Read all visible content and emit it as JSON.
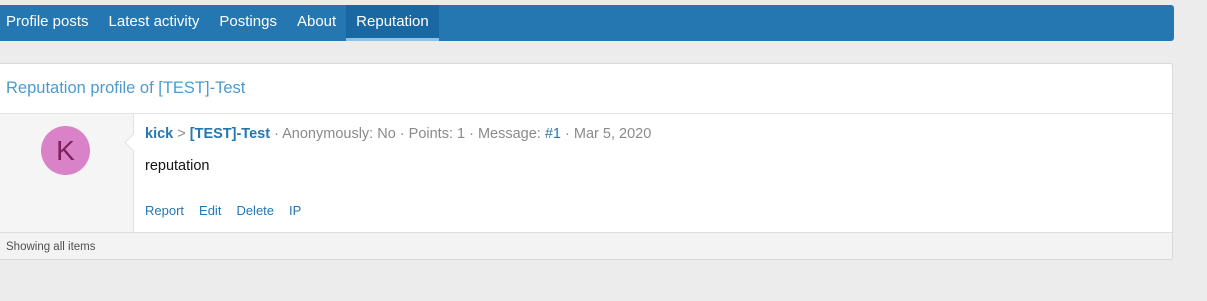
{
  "tabs": [
    {
      "label": "Profile posts"
    },
    {
      "label": "Latest activity"
    },
    {
      "label": "Postings"
    },
    {
      "label": "About"
    },
    {
      "label": "Reputation"
    }
  ],
  "block": {
    "title": "Reputation profile of [TEST]-Test",
    "footer": "Showing all items"
  },
  "entry": {
    "avatar_letter": "K",
    "avatar_color": "#da82c7",
    "from_user": "kick",
    "separator": ">",
    "to_user": "[TEST]-Test",
    "anonymous": "· Anonymously: No · Points: 1 · Message:",
    "message_link": "#1",
    "date": "· Mar 5, 2020",
    "body": "reputation",
    "actions": [
      "Report",
      "Edit",
      "Delete",
      "IP"
    ]
  },
  "colors": {
    "accent": "#2577b1",
    "title": "#4c9bcf",
    "background": "#ececec"
  }
}
